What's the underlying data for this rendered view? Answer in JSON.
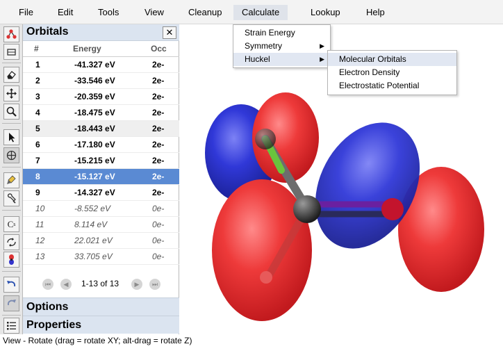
{
  "menubar": {
    "items": [
      "File",
      "Edit",
      "Tools",
      "View",
      "Cleanup",
      "Calculate",
      "Lookup",
      "Help"
    ]
  },
  "calculate_menu": {
    "items": [
      "Strain Energy",
      "Symmetry",
      "Huckel"
    ]
  },
  "huckel_submenu": {
    "items": [
      "Molecular Orbitals",
      "Electron Density",
      "Electrostatic Potential"
    ]
  },
  "orbitals_panel": {
    "title": "Orbitals",
    "close_icon": "close-icon",
    "columns": [
      "#",
      "Energy",
      "Occ"
    ],
    "rows": [
      {
        "num": "1",
        "energy": "-41.327 eV",
        "occ": "2e-"
      },
      {
        "num": "2",
        "energy": "-33.546 eV",
        "occ": "2e-"
      },
      {
        "num": "3",
        "energy": "-20.359 eV",
        "occ": "2e-"
      },
      {
        "num": "4",
        "energy": "-18.475 eV",
        "occ": "2e-"
      },
      {
        "num": "5",
        "energy": "-18.443 eV",
        "occ": "2e-"
      },
      {
        "num": "6",
        "energy": "-17.180 eV",
        "occ": "2e-"
      },
      {
        "num": "7",
        "energy": "-15.215 eV",
        "occ": "2e-"
      },
      {
        "num": "8",
        "energy": "-15.127 eV",
        "occ": "2e-"
      },
      {
        "num": "9",
        "energy": "-14.327 eV",
        "occ": "2e-"
      },
      {
        "num": "10",
        "energy": "-8.552 eV",
        "occ": "0e-"
      },
      {
        "num": "11",
        "energy": "8.114 eV",
        "occ": "0e-"
      },
      {
        "num": "12",
        "energy": "22.021 eV",
        "occ": "0e-"
      },
      {
        "num": "13",
        "energy": "33.705 eV",
        "occ": "0e-"
      }
    ],
    "selected_row": "8",
    "pager_text": "1-13 of 13"
  },
  "sections": {
    "options": "Options",
    "properties": "Properties"
  },
  "toolbar": {
    "icons": [
      "molecule-template-icon",
      "ring-template-icon",
      "eraser-icon",
      "move-icon",
      "zoom-icon",
      "select-arrow-icon",
      "center-icon",
      "clean-icon",
      "wrench-icon",
      "symmetry-cs-icon",
      "clean-3d-icon",
      "orbital-icon",
      "undo-icon",
      "redo-icon",
      "list-icon"
    ],
    "cs_label": "C",
    "cs_sub": "s"
  },
  "status": "View - Rotate (drag = rotate XY; alt-drag = rotate Z)",
  "colors": {
    "selected_row": "#5a8ad3",
    "panel_header": "#dbe4f0",
    "lobe_red": "#e0262b",
    "lobe_blue": "#2a32c8"
  }
}
